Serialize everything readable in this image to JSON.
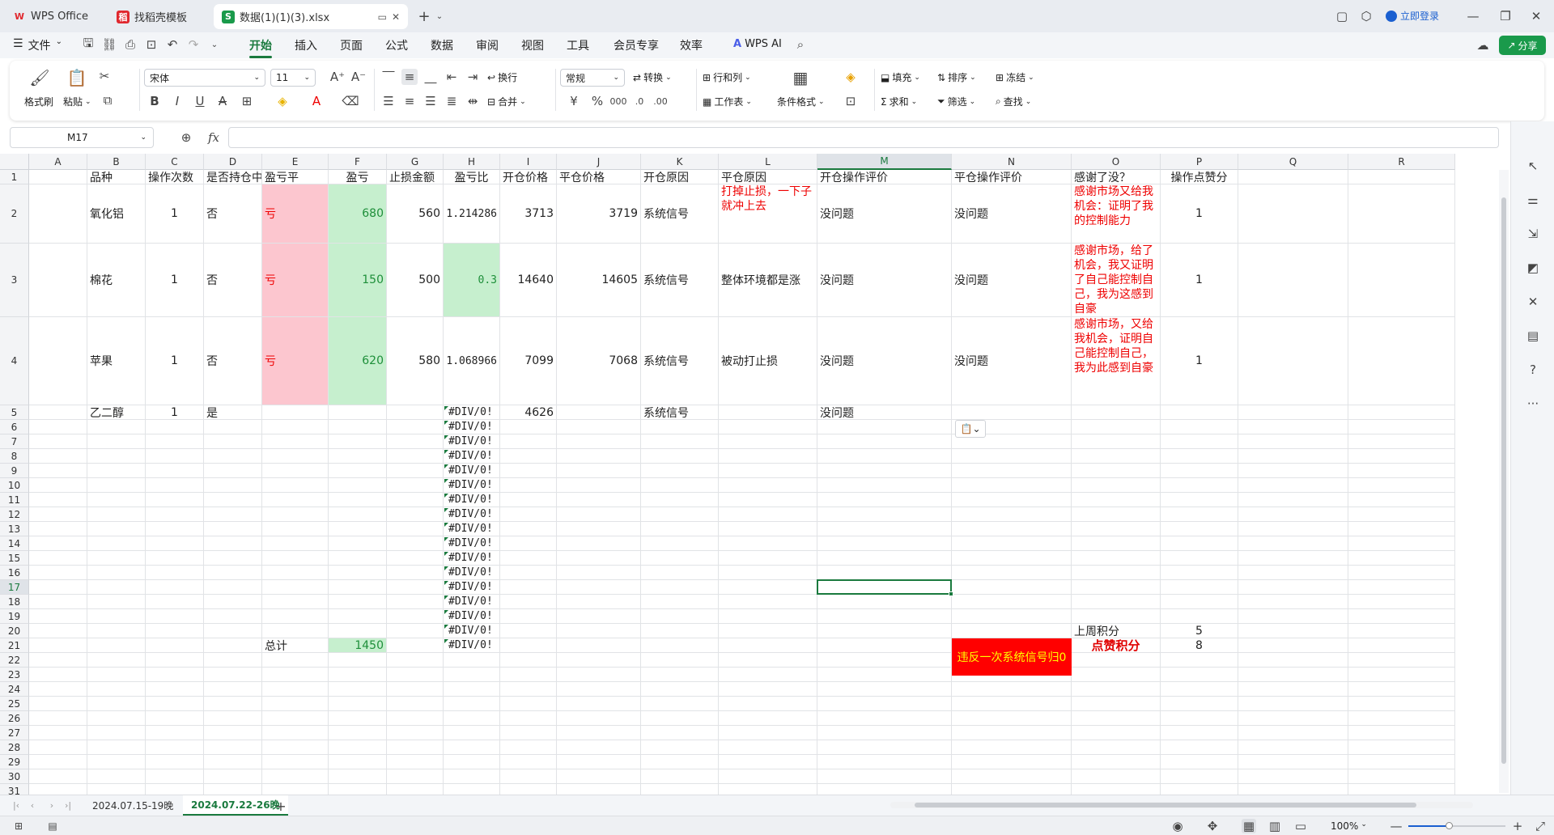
{
  "tabs": [
    {
      "label": "WPS Office",
      "logo": "W",
      "color": "#e0282e"
    },
    {
      "label": "找稻壳模板",
      "logo": "稻",
      "color": "#e0282e"
    },
    {
      "label": "数据(1)(1)(3).xlsx",
      "logo": "S",
      "color": "#1a9a4b"
    }
  ],
  "header": {
    "login": "立即登录",
    "share": "分享"
  },
  "menu": {
    "file": "文件",
    "items": [
      "开始",
      "插入",
      "页面",
      "公式",
      "数据",
      "审阅",
      "视图",
      "工具",
      "会员专享",
      "效率"
    ],
    "active": "开始",
    "wps_ai": "WPS AI"
  },
  "ribbon": {
    "format_brush": "格式刷",
    "paste": "粘贴",
    "font": "宋体",
    "size": "11",
    "wrap": "换行",
    "merge": "合并",
    "num_format": "常规",
    "convert": "转换",
    "row_col": "行和列",
    "worksheet": "工作表",
    "cond_format": "条件格式",
    "fill": "填充",
    "sort": "排序",
    "freeze": "冻结",
    "sum": "求和",
    "filter": "筛选",
    "find": "查找"
  },
  "formula": {
    "cell_ref": "M17",
    "fx": "fx",
    "value": ""
  },
  "columns": [
    {
      "name": "A",
      "w": 72
    },
    {
      "name": "B",
      "w": 72
    },
    {
      "name": "C",
      "w": 72
    },
    {
      "name": "D",
      "w": 72
    },
    {
      "name": "E",
      "w": 82
    },
    {
      "name": "F",
      "w": 72
    },
    {
      "name": "G",
      "w": 70
    },
    {
      "name": "H",
      "w": 70
    },
    {
      "name": "I",
      "w": 70
    },
    {
      "name": "J",
      "w": 104
    },
    {
      "name": "K",
      "w": 96
    },
    {
      "name": "L",
      "w": 122
    },
    {
      "name": "M",
      "w": 166
    },
    {
      "name": "N",
      "w": 148
    },
    {
      "name": "O",
      "w": 110
    },
    {
      "name": "P",
      "w": 96
    },
    {
      "name": "Q",
      "w": 136
    },
    {
      "name": "R",
      "w": 132
    }
  ],
  "row_heights": [
    18,
    73,
    91,
    109,
    18,
    18,
    18,
    18,
    18,
    18,
    18,
    18,
    18,
    18,
    18,
    18,
    18,
    18,
    18,
    18,
    18,
    18,
    18,
    18,
    18,
    18,
    18,
    18,
    18,
    18,
    18
  ],
  "selected": {
    "col": "M",
    "row": 17
  },
  "cells": [
    {
      "r": 1,
      "c": "B",
      "v": "品种"
    },
    {
      "r": 1,
      "c": "C",
      "v": "操作次数"
    },
    {
      "r": 1,
      "c": "D",
      "v": "是否持仓中"
    },
    {
      "r": 1,
      "c": "E",
      "v": "盈亏平"
    },
    {
      "r": 1,
      "c": "F",
      "v": "盈亏",
      "align": "ctr"
    },
    {
      "r": 1,
      "c": "G",
      "v": "止损金额"
    },
    {
      "r": 1,
      "c": "H",
      "v": "盈亏比",
      "align": "ctr"
    },
    {
      "r": 1,
      "c": "I",
      "v": "开仓价格"
    },
    {
      "r": 1,
      "c": "J",
      "v": "平仓价格"
    },
    {
      "r": 1,
      "c": "K",
      "v": "开仓原因"
    },
    {
      "r": 1,
      "c": "L",
      "v": "平仓原因"
    },
    {
      "r": 1,
      "c": "M",
      "v": "开仓操作评价"
    },
    {
      "r": 1,
      "c": "N",
      "v": "平仓操作评价"
    },
    {
      "r": 1,
      "c": "O",
      "v": "感谢了没？"
    },
    {
      "r": 1,
      "c": "P",
      "v": "操作点赞分",
      "align": "ctr"
    },
    {
      "r": 2,
      "c": "B",
      "v": "氧化铝"
    },
    {
      "r": 2,
      "c": "C",
      "v": "1",
      "align": "ctr"
    },
    {
      "r": 2,
      "c": "D",
      "v": "否"
    },
    {
      "r": 2,
      "c": "E",
      "v": "亏",
      "color": "red",
      "bg": "#fcc6cf"
    },
    {
      "r": 2,
      "c": "F",
      "v": "680",
      "align": "r",
      "color": "green",
      "bg": "#c6efce"
    },
    {
      "r": 2,
      "c": "G",
      "v": "560",
      "align": "r"
    },
    {
      "r": 2,
      "c": "H",
      "v": "1.214286",
      "align": "r",
      "mono": true
    },
    {
      "r": 2,
      "c": "I",
      "v": "3713",
      "align": "r"
    },
    {
      "r": 2,
      "c": "J",
      "v": "3719",
      "align": "r"
    },
    {
      "r": 2,
      "c": "K",
      "v": "系统信号"
    },
    {
      "r": 2,
      "c": "L",
      "v": "打掉止损，一下子就冲上去",
      "color": "red",
      "wrap": true
    },
    {
      "r": 2,
      "c": "M",
      "v": "没问题"
    },
    {
      "r": 2,
      "c": "N",
      "v": "没问题"
    },
    {
      "r": 2,
      "c": "O",
      "v": "感谢市场又给我机会：证明了我的控制能力",
      "color": "red",
      "wrap": true
    },
    {
      "r": 2,
      "c": "P",
      "v": "1",
      "align": "ctr"
    },
    {
      "r": 3,
      "c": "B",
      "v": "棉花"
    },
    {
      "r": 3,
      "c": "C",
      "v": "1",
      "align": "ctr"
    },
    {
      "r": 3,
      "c": "D",
      "v": "否"
    },
    {
      "r": 3,
      "c": "E",
      "v": "亏",
      "color": "red",
      "bg": "#fcc6cf"
    },
    {
      "r": 3,
      "c": "F",
      "v": "150",
      "align": "r",
      "color": "green",
      "bg": "#c6efce"
    },
    {
      "r": 3,
      "c": "G",
      "v": "500",
      "align": "r"
    },
    {
      "r": 3,
      "c": "H",
      "v": "0.3",
      "align": "r",
      "mono": true,
      "color": "green",
      "bg": "#c6efce"
    },
    {
      "r": 3,
      "c": "I",
      "v": "14640",
      "align": "r"
    },
    {
      "r": 3,
      "c": "J",
      "v": "14605",
      "align": "r"
    },
    {
      "r": 3,
      "c": "K",
      "v": "系统信号"
    },
    {
      "r": 3,
      "c": "L",
      "v": "整体环境都是涨"
    },
    {
      "r": 3,
      "c": "M",
      "v": "没问题"
    },
    {
      "r": 3,
      "c": "N",
      "v": "没问题"
    },
    {
      "r": 3,
      "c": "O",
      "v": "感谢市场，给了机会，我又证明了自己能控制自己，我为这感到自豪",
      "color": "red",
      "wrap": true
    },
    {
      "r": 3,
      "c": "P",
      "v": "1",
      "align": "ctr"
    },
    {
      "r": 4,
      "c": "B",
      "v": "苹果"
    },
    {
      "r": 4,
      "c": "C",
      "v": "1",
      "align": "ctr"
    },
    {
      "r": 4,
      "c": "D",
      "v": "否"
    },
    {
      "r": 4,
      "c": "E",
      "v": "亏",
      "color": "red",
      "bg": "#fcc6cf"
    },
    {
      "r": 4,
      "c": "F",
      "v": "620",
      "align": "r",
      "color": "green",
      "bg": "#c6efce"
    },
    {
      "r": 4,
      "c": "G",
      "v": "580",
      "align": "r"
    },
    {
      "r": 4,
      "c": "H",
      "v": "1.068966",
      "align": "r",
      "mono": true
    },
    {
      "r": 4,
      "c": "I",
      "v": "7099",
      "align": "r"
    },
    {
      "r": 4,
      "c": "J",
      "v": "7068",
      "align": "r"
    },
    {
      "r": 4,
      "c": "K",
      "v": "系统信号"
    },
    {
      "r": 4,
      "c": "L",
      "v": "被动打止损"
    },
    {
      "r": 4,
      "c": "M",
      "v": "没问题"
    },
    {
      "r": 4,
      "c": "N",
      "v": "没问题"
    },
    {
      "r": 4,
      "c": "O",
      "v": "感谢市场，又给我机会，证明自己能控制自己，我为此感到自豪",
      "color": "red",
      "wrap": true
    },
    {
      "r": 4,
      "c": "P",
      "v": "1",
      "align": "ctr"
    },
    {
      "r": 5,
      "c": "B",
      "v": "乙二醇"
    },
    {
      "r": 5,
      "c": "C",
      "v": "1",
      "align": "ctr"
    },
    {
      "r": 5,
      "c": "D",
      "v": "是"
    },
    {
      "r": 5,
      "c": "I",
      "v": "4626",
      "align": "r"
    },
    {
      "r": 5,
      "c": "K",
      "v": "系统信号"
    },
    {
      "r": 5,
      "c": "M",
      "v": "没问题"
    },
    {
      "r": 20,
      "c": "O",
      "v": "上周积分"
    },
    {
      "r": 20,
      "c": "P",
      "v": "5",
      "align": "ctr"
    },
    {
      "r": 21,
      "c": "E",
      "v": "总计"
    },
    {
      "r": 21,
      "c": "F",
      "v": "1450",
      "align": "r",
      "color": "green",
      "bg": "#c6efce"
    },
    {
      "r": 21,
      "c": "P",
      "v": "8",
      "align": "ctr"
    }
  ],
  "div_error": "#DIV/0!",
  "div_error_rows": [
    5,
    6,
    7,
    8,
    9,
    10,
    11,
    12,
    13,
    14,
    15,
    16,
    17,
    18,
    19,
    20,
    21
  ],
  "violation": {
    "text": "违反一次系统信号归0",
    "bg": "#ff0000",
    "color": "#ffff00"
  },
  "like_score": {
    "text": "点赞积分",
    "color": "#e00000"
  },
  "sheets": [
    "2024.07.15-19晚",
    "2024.07.22-26晚"
  ],
  "active_sheet": "2024.07.22-26晚",
  "status": {
    "zoom": "100%"
  }
}
